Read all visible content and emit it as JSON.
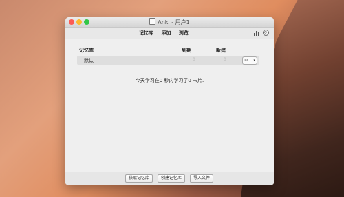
{
  "window": {
    "title": "Anki - 用户1"
  },
  "toolbar": {
    "decks": "记忆库",
    "add": "添加",
    "browse": "浏览"
  },
  "table": {
    "headers": {
      "deck": "记忆库",
      "due": "到期",
      "new": "新建"
    },
    "rows": [
      {
        "name": "默认",
        "due": "0",
        "new": "0"
      }
    ]
  },
  "summary": "今天学习在0 秒内学习了0 卡片.",
  "bottom": {
    "get_shared": "获取记忆库",
    "create_deck": "创建记忆库",
    "import_file": "导入文件"
  },
  "icons": {
    "stats": "bar-chart-icon",
    "sync": "sync-icon",
    "deck_options": "gear-icon"
  },
  "colors": {
    "close": "#fc5c54",
    "minimize": "#fdbb2f",
    "maximize": "#33c748"
  }
}
